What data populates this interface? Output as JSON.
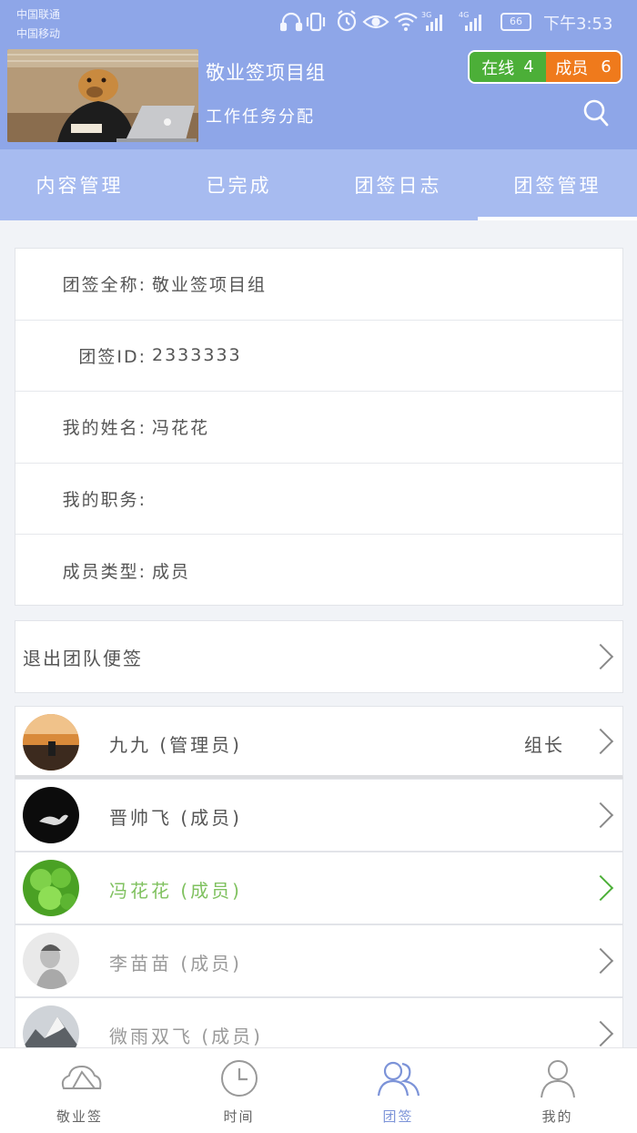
{
  "status_bar": {
    "carrier1": "中国联通",
    "carrier2": "中国移动",
    "battery": "66",
    "time": "下午3:53"
  },
  "header": {
    "group_name": "敬业签项目组",
    "subtitle": "工作任务分配",
    "online_label": "在线",
    "online_count": "4",
    "member_label": "成员",
    "member_count": "6",
    "search_icon": "search-icon"
  },
  "tabs": [
    {
      "label": "内容管理",
      "active": false
    },
    {
      "label": "已完成",
      "active": false
    },
    {
      "label": "团签日志",
      "active": false
    },
    {
      "label": "团签管理",
      "active": true
    }
  ],
  "info": {
    "full_name_label": "团签全称:",
    "full_name_value": "敬业签项目组",
    "id_label": "团签ID:",
    "id_value": "2333333",
    "my_name_label": "我的姓名:",
    "my_name_value": "冯花花",
    "my_position_label": "我的职务:",
    "my_position_value": "",
    "member_type_label": "成员类型:",
    "member_type_value": "成员"
  },
  "exit": {
    "label": "退出团队便签"
  },
  "members": [
    {
      "name": "九九 (管理员)",
      "role": "组长"
    },
    {
      "name": "晋帅飞 (成员)",
      "role": ""
    },
    {
      "name": "冯花花 (成员)",
      "role": ""
    },
    {
      "name": "李苗苗 (成员)",
      "role": ""
    },
    {
      "name": "微雨双飞 (成员)",
      "role": ""
    }
  ],
  "bottom_nav": [
    {
      "label": "敬业签",
      "icon": "cloud-note-icon"
    },
    {
      "label": "时间",
      "icon": "clock-icon"
    },
    {
      "label": "团签",
      "icon": "team-icon"
    },
    {
      "label": "我的",
      "icon": "person-icon"
    }
  ],
  "colors": {
    "header_bg": "#8ea6e8",
    "tabs_bg": "#a7bbf0",
    "online_green": "#4caf38",
    "member_orange": "#ef7a1c",
    "nav_active": "#7c93d8"
  }
}
